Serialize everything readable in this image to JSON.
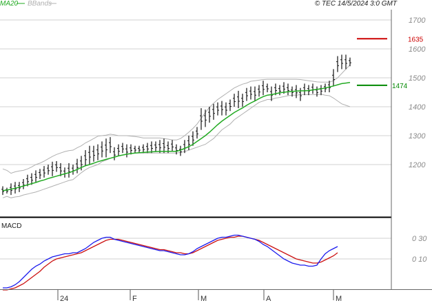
{
  "header": {
    "legend": [
      {
        "name": "MA20",
        "color": "#22aa22"
      },
      {
        "name": "BBands",
        "color": "#b0b0b0"
      }
    ],
    "source": "© TEC 14/5/2024 3:0 GMT"
  },
  "colors": {
    "price": "#111111",
    "ma20": "#22aa22",
    "bbands": "#b0b0b0",
    "resistance": "#cc0000",
    "support": "#008800",
    "macd": "#1a1aee",
    "signal": "#cc1111",
    "grid": "#d0d0d0"
  },
  "chart_data": [
    {
      "type": "line",
      "title": "",
      "ylim": [
        1090,
        1770
      ],
      "y_ticks": [
        1200,
        1300,
        1400,
        1500,
        1600,
        1700
      ],
      "x_ticks": [
        "24",
        "F",
        "M",
        "A",
        "M"
      ],
      "levels": [
        {
          "label": "1635",
          "value": 1635,
          "color": "#cc0000"
        },
        {
          "label": "1474",
          "value": 1474,
          "color": "#008800"
        }
      ],
      "ohlc_highs": [
        1125,
        1120,
        1135,
        1140,
        1140,
        1150,
        1165,
        1170,
        1180,
        1185,
        1195,
        1200,
        1210,
        1212,
        1205,
        1190,
        1205,
        1200,
        1220,
        1230,
        1250,
        1265,
        1265,
        1270,
        1280,
        1290,
        1295,
        1260,
        1270,
        1275,
        1270,
        1270,
        1265,
        1265,
        1270,
        1275,
        1280,
        1280,
        1285,
        1290,
        1280,
        1285,
        1270,
        1265,
        1285,
        1300,
        1315,
        1330,
        1395,
        1390,
        1400,
        1410,
        1415,
        1420,
        1415,
        1425,
        1445,
        1455,
        1445,
        1465,
        1470,
        1470,
        1475,
        1490,
        1480,
        1470,
        1480,
        1475,
        1485,
        1480,
        1470,
        1475,
        1465,
        1480,
        1475,
        1480,
        1470,
        1475,
        1480,
        1490,
        1530,
        1575,
        1580,
        1580,
        1570
      ],
      "ohlc_lows": [
        1095,
        1100,
        1095,
        1100,
        1105,
        1115,
        1125,
        1130,
        1140,
        1150,
        1155,
        1165,
        1160,
        1175,
        1160,
        1155,
        1155,
        1165,
        1170,
        1180,
        1195,
        1200,
        1210,
        1215,
        1225,
        1225,
        1240,
        1215,
        1230,
        1240,
        1225,
        1235,
        1240,
        1240,
        1240,
        1240,
        1240,
        1245,
        1240,
        1240,
        1240,
        1245,
        1235,
        1230,
        1240,
        1250,
        1265,
        1290,
        1320,
        1330,
        1345,
        1355,
        1370,
        1370,
        1370,
        1385,
        1400,
        1395,
        1400,
        1420,
        1425,
        1420,
        1435,
        1440,
        1450,
        1420,
        1440,
        1440,
        1445,
        1440,
        1435,
        1430,
        1420,
        1440,
        1440,
        1445,
        1435,
        1440,
        1450,
        1450,
        1470,
        1520,
        1530,
        1530,
        1540
      ],
      "ma20": [
        1110,
        1112,
        1115,
        1118,
        1122,
        1126,
        1130,
        1134,
        1138,
        1143,
        1147,
        1152,
        1156,
        1160,
        1164,
        1168,
        1172,
        1177,
        1183,
        1190,
        1196,
        1200,
        1205,
        1210,
        1214,
        1218,
        1222,
        1226,
        1230,
        1233,
        1236,
        1238,
        1240,
        1241,
        1242,
        1243,
        1244,
        1245,
        1246,
        1246,
        1246,
        1246,
        1246,
        1250,
        1256,
        1262,
        1270,
        1280,
        1290,
        1300,
        1312,
        1325,
        1338,
        1350,
        1360,
        1370,
        1380,
        1388,
        1396,
        1405,
        1413,
        1420,
        1428,
        1435,
        1440,
        1442,
        1445,
        1448,
        1450,
        1452,
        1453,
        1454,
        1455,
        1455,
        1456,
        1458,
        1460,
        1462,
        1465,
        1468,
        1472,
        1476,
        1480,
        1482,
        1484
      ],
      "bb_upper": [
        1185,
        1180,
        1170,
        1175,
        1178,
        1180,
        1185,
        1192,
        1200,
        1205,
        1212,
        1220,
        1228,
        1235,
        1240,
        1245,
        1248,
        1250,
        1258,
        1265,
        1275,
        1282,
        1290,
        1298,
        1300,
        1302,
        1305,
        1303,
        1300,
        1300,
        1300,
        1298,
        1297,
        1295,
        1292,
        1292,
        1292,
        1292,
        1292,
        1290,
        1288,
        1285,
        1285,
        1290,
        1300,
        1312,
        1325,
        1340,
        1360,
        1380,
        1398,
        1412,
        1425,
        1435,
        1445,
        1455,
        1465,
        1472,
        1478,
        1482,
        1488,
        1490,
        1492,
        1494,
        1495,
        1495,
        1495,
        1495,
        1495,
        1495,
        1495,
        1495,
        1494,
        1492,
        1490,
        1488,
        1486,
        1485,
        1485,
        1485,
        1490,
        1500,
        1515,
        1530,
        1545
      ],
      "bb_lower": [
        1085,
        1090,
        1085,
        1088,
        1090,
        1095,
        1098,
        1102,
        1105,
        1110,
        1115,
        1120,
        1125,
        1130,
        1135,
        1140,
        1145,
        1148,
        1160,
        1172,
        1182,
        1190,
        1195,
        1200,
        1210,
        1215,
        1222,
        1225,
        1230,
        1233,
        1235,
        1238,
        1240,
        1240,
        1240,
        1240,
        1240,
        1240,
        1240,
        1240,
        1240,
        1240,
        1240,
        1242,
        1245,
        1250,
        1255,
        1260,
        1265,
        1270,
        1280,
        1290,
        1305,
        1320,
        1330,
        1340,
        1355,
        1365,
        1375,
        1385,
        1395,
        1405,
        1415,
        1420,
        1425,
        1425,
        1430,
        1432,
        1435,
        1438,
        1440,
        1440,
        1442,
        1442,
        1442,
        1442,
        1442,
        1443,
        1440,
        1438,
        1430,
        1420,
        1410,
        1405,
        1400
      ]
    },
    {
      "type": "line",
      "title": "MACD",
      "ylim": [
        -22,
        37
      ],
      "y_ticks": [
        10,
        30
      ],
      "y_tick_labels": [
        "0 10",
        "0 30"
      ],
      "series": [
        {
          "name": "",
          "color": "#1a1aee",
          "values": [
            -18,
            -18,
            -17,
            -15,
            -12,
            -8,
            -4,
            0,
            3,
            5,
            8,
            10,
            12,
            13,
            14,
            15,
            15,
            16,
            16,
            18,
            20,
            23,
            26,
            28,
            30,
            31,
            31,
            29,
            28,
            27,
            26,
            25,
            24,
            23,
            22,
            21,
            20,
            19,
            18,
            18,
            17,
            16,
            15,
            14,
            14,
            15,
            17,
            20,
            22,
            24,
            26,
            28,
            30,
            31,
            31,
            32,
            33,
            33,
            32,
            31,
            30,
            29,
            27,
            24,
            22,
            19,
            16,
            13,
            10,
            8,
            6,
            5,
            4,
            4,
            3,
            3,
            4,
            10,
            15,
            18,
            20,
            22
          ]
        },
        {
          "name": "",
          "color": "#cc1111",
          "values": [
            -20,
            -20,
            -19,
            -18,
            -16,
            -14,
            -11,
            -8,
            -5,
            -2,
            2,
            5,
            8,
            10,
            11,
            12,
            13,
            14,
            15,
            16,
            18,
            20,
            22,
            24,
            26,
            28,
            29,
            29,
            29,
            28,
            27,
            26,
            25,
            24,
            23,
            22,
            21,
            20,
            19,
            19,
            18,
            17,
            16,
            16,
            15,
            15,
            16,
            18,
            20,
            22,
            24,
            26,
            28,
            29,
            30,
            31,
            31,
            32,
            32,
            31,
            30,
            29,
            28,
            26,
            24,
            22,
            20,
            18,
            16,
            14,
            12,
            10,
            9,
            8,
            7,
            6,
            6,
            7,
            9,
            11,
            13,
            16
          ]
        }
      ]
    }
  ]
}
